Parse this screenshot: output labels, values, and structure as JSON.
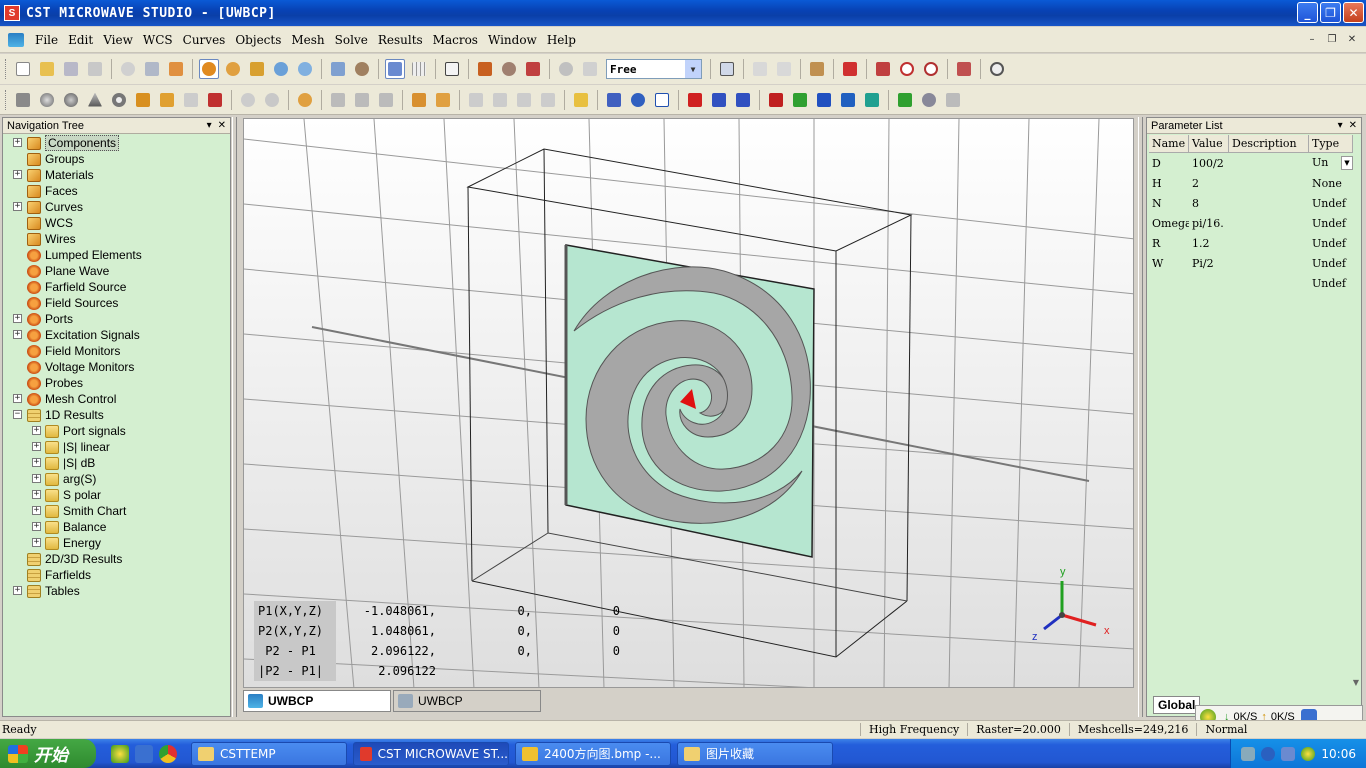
{
  "window": {
    "title": "CST MICROWAVE STUDIO - [UWBCP]",
    "app_icon": "cst-logo-icon"
  },
  "menu": [
    "File",
    "Edit",
    "View",
    "WCS",
    "Curves",
    "Objects",
    "Mesh",
    "Solve",
    "Results",
    "Macros",
    "Window",
    "Help"
  ],
  "toolbar": {
    "view_mode": "Free"
  },
  "navigation_tree": {
    "title": "Navigation Tree",
    "items": [
      {
        "label": "Components",
        "icon": "cube",
        "expandable": true,
        "level": 0,
        "selected": true
      },
      {
        "label": "Groups",
        "icon": "cube",
        "expandable": false,
        "level": 0
      },
      {
        "label": "Materials",
        "icon": "cube",
        "expandable": true,
        "level": 0
      },
      {
        "label": "Faces",
        "icon": "cube",
        "expandable": false,
        "level": 0
      },
      {
        "label": "Curves",
        "icon": "cube",
        "expandable": true,
        "level": 0
      },
      {
        "label": "WCS",
        "icon": "cube",
        "expandable": false,
        "level": 0
      },
      {
        "label": "Wires",
        "icon": "cube",
        "expandable": false,
        "level": 0
      },
      {
        "label": "Lumped Elements",
        "icon": "gear",
        "expandable": false,
        "level": 0
      },
      {
        "label": "Plane Wave",
        "icon": "gear",
        "expandable": false,
        "level": 0
      },
      {
        "label": "Farfield Source",
        "icon": "gear",
        "expandable": false,
        "level": 0
      },
      {
        "label": "Field Sources",
        "icon": "gear",
        "expandable": false,
        "level": 0
      },
      {
        "label": "Ports",
        "icon": "gear",
        "expandable": true,
        "level": 0
      },
      {
        "label": "Excitation Signals",
        "icon": "gear",
        "expandable": true,
        "level": 0
      },
      {
        "label": "Field Monitors",
        "icon": "gear",
        "expandable": false,
        "level": 0
      },
      {
        "label": "Voltage Monitors",
        "icon": "gear",
        "expandable": false,
        "level": 0
      },
      {
        "label": "Probes",
        "icon": "gear",
        "expandable": false,
        "level": 0
      },
      {
        "label": "Mesh Control",
        "icon": "gear",
        "expandable": true,
        "level": 0
      },
      {
        "label": "1D Results",
        "icon": "stack",
        "expandable": true,
        "expanded": true,
        "level": 0
      },
      {
        "label": "Port signals",
        "icon": "folder",
        "expandable": true,
        "level": 1
      },
      {
        "label": "|S| linear",
        "icon": "folder",
        "expandable": true,
        "level": 1
      },
      {
        "label": "|S| dB",
        "icon": "folder",
        "expandable": true,
        "level": 1
      },
      {
        "label": "arg(S)",
        "icon": "folder",
        "expandable": true,
        "level": 1
      },
      {
        "label": "S polar",
        "icon": "folder",
        "expandable": true,
        "level": 1
      },
      {
        "label": "Smith Chart",
        "icon": "folder",
        "expandable": true,
        "level": 1
      },
      {
        "label": "Balance",
        "icon": "folder",
        "expandable": true,
        "level": 1
      },
      {
        "label": "Energy",
        "icon": "folder",
        "expandable": true,
        "level": 1
      },
      {
        "label": "2D/3D Results",
        "icon": "stack",
        "expandable": false,
        "level": 0
      },
      {
        "label": "Farfields",
        "icon": "stack",
        "expandable": false,
        "level": 0
      },
      {
        "label": "Tables",
        "icon": "stack",
        "expandable": true,
        "level": 0
      }
    ]
  },
  "measurement": {
    "rows": [
      {
        "label": "P1(X,Y,Z)",
        "x": "-1.048061,",
        "y": "0,",
        "z": "0"
      },
      {
        "label": "P2(X,Y,Z)",
        "x": "1.048061,",
        "y": "0,",
        "z": "0"
      },
      {
        "label": " P2 - P1",
        "x": "2.096122,",
        "y": "0,",
        "z": "0"
      },
      {
        "label": "|P2 - P1|",
        "x": "2.096122",
        "y": "",
        "z": ""
      }
    ]
  },
  "axes": {
    "x": "x",
    "y": "y",
    "z": "z"
  },
  "colors": {
    "substrate": "#b6e6d0",
    "spiral": "#a6a6a6",
    "port": "#e01010",
    "panel_bg": "#d4efd0",
    "titlebar": "#0a50c8"
  },
  "doc_tabs": [
    {
      "label": "UWBCP",
      "active": true
    },
    {
      "label": "UWBCP",
      "active": false
    }
  ],
  "parameter_list": {
    "title": "Parameter List",
    "columns": [
      "Name",
      "Value",
      "Description",
      "Type"
    ],
    "rows": [
      {
        "name": "D",
        "value": "100/2",
        "description": "",
        "type": "Un"
      },
      {
        "name": "H",
        "value": "2",
        "description": "",
        "type": "None"
      },
      {
        "name": "N",
        "value": "8",
        "description": "",
        "type": "Undef"
      },
      {
        "name": "Omega",
        "value": "pi/16.",
        "description": "",
        "type": "Undef"
      },
      {
        "name": "R",
        "value": "1.2",
        "description": "",
        "type": "Undef"
      },
      {
        "name": "W",
        "value": "Pi/2",
        "description": "",
        "type": "Undef"
      },
      {
        "name": "",
        "value": "",
        "description": "",
        "type": "Undef"
      }
    ],
    "tab": "Global"
  },
  "net_meter": {
    "down": "0K/S",
    "up": "0K/S"
  },
  "status": {
    "ready": "Ready",
    "frequency": "High Frequency",
    "raster": "Raster=20.000",
    "meshcells": "Meshcells=249,216",
    "extra": "Normal"
  },
  "taskbar": {
    "start": "开始",
    "buttons": [
      {
        "label": "CSTTEMP",
        "active": false
      },
      {
        "label": "CST MICROWAVE ST...",
        "active": true
      },
      {
        "label": "2400方向图.bmp -...",
        "active": false
      },
      {
        "label": "图片收藏",
        "active": false
      }
    ],
    "clock": "10:06"
  }
}
